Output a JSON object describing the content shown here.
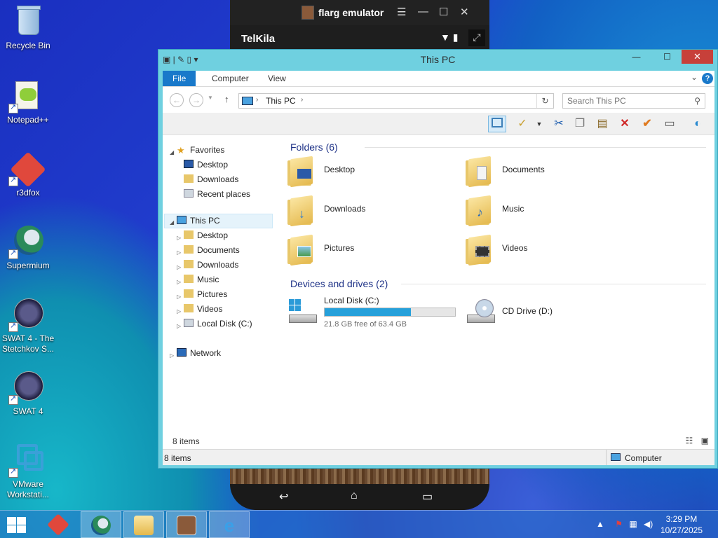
{
  "desktop": {
    "icons": [
      {
        "label": "Recycle Bin"
      },
      {
        "label": "Notepad++"
      },
      {
        "label": "r3dfox"
      },
      {
        "label": "Supermium"
      },
      {
        "label": "SWAT 4 - The Stetchkov S..."
      },
      {
        "label": "SWAT 4"
      },
      {
        "label": "VMware Workstati..."
      }
    ]
  },
  "emulator": {
    "title": "flarg emulator",
    "controls": [
      "☰",
      "—",
      "☐",
      "✕"
    ],
    "app_name": "TelKila",
    "nav": [
      "↩",
      "⌂",
      "▭"
    ]
  },
  "explorer": {
    "title": "This PC",
    "tabs": [
      "File",
      "Computer",
      "View"
    ],
    "address": "This PC",
    "search_placeholder": "Search This PC",
    "nav": {
      "favorites": "Favorites",
      "favorites_items": [
        "Desktop",
        "Downloads",
        "Recent places"
      ],
      "this_pc": "This PC",
      "this_pc_items": [
        "Desktop",
        "Documents",
        "Downloads",
        "Music",
        "Pictures",
        "Videos",
        "Local Disk (C:)"
      ],
      "network": "Network"
    },
    "folders_header": "Folders (6)",
    "folders": [
      "Desktop",
      "Documents",
      "Downloads",
      "Music",
      "Pictures",
      "Videos"
    ],
    "drives_header": "Devices and drives (2)",
    "drives": [
      {
        "name": "Local Disk (C:)",
        "free": "21.8 GB free of 63.4 GB",
        "used_fraction": 0.66
      },
      {
        "name": "CD Drive (D:)"
      }
    ],
    "status_count": "8 items",
    "outer_status_count": "8 items",
    "zone": "Computer"
  },
  "taskbar": {
    "clock_time": "3:29 PM",
    "clock_date": "10/27/2025"
  },
  "colors": {
    "accent": "#1979ca",
    "drive_bar": "#26a0da",
    "close": "#c7403a"
  }
}
